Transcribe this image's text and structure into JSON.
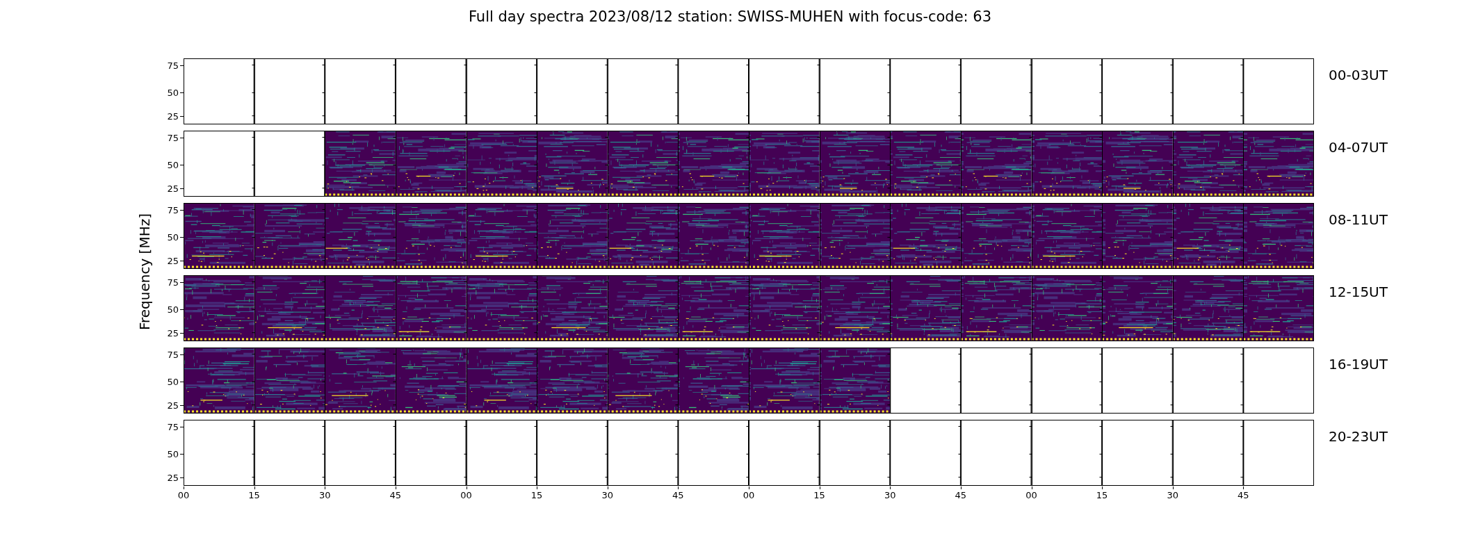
{
  "title": "Full day spectra 2023/08/12 station: SWISS-MUHEN with focus-code: 63",
  "ylabel": "Frequency [MHz]",
  "rows": [
    {
      "label": "00-03UT",
      "yticks": [
        "75",
        "50",
        "25"
      ],
      "panels": [
        {
          "data": false
        },
        {
          "data": false
        },
        {
          "data": false
        },
        {
          "data": false
        },
        {
          "data": false
        },
        {
          "data": false
        },
        {
          "data": false
        },
        {
          "data": false
        },
        {
          "data": false
        },
        {
          "data": false
        },
        {
          "data": false
        },
        {
          "data": false
        },
        {
          "data": false
        },
        {
          "data": false
        },
        {
          "data": false
        },
        {
          "data": false
        }
      ]
    },
    {
      "label": "04-07UT",
      "yticks": [
        "75",
        "50",
        "25"
      ],
      "panels": [
        {
          "data": false
        },
        {
          "data": false
        },
        {
          "data": true
        },
        {
          "data": true
        },
        {
          "data": true
        },
        {
          "data": true
        },
        {
          "data": true
        },
        {
          "data": true
        },
        {
          "data": true
        },
        {
          "data": true
        },
        {
          "data": true
        },
        {
          "data": true
        },
        {
          "data": true
        },
        {
          "data": true
        },
        {
          "data": true
        },
        {
          "data": true
        }
      ]
    },
    {
      "label": "08-11UT",
      "yticks": [
        "75",
        "50",
        "25"
      ],
      "panels": [
        {
          "data": true
        },
        {
          "data": true
        },
        {
          "data": true
        },
        {
          "data": true
        },
        {
          "data": true
        },
        {
          "data": true
        },
        {
          "data": true
        },
        {
          "data": true
        },
        {
          "data": true
        },
        {
          "data": true
        },
        {
          "data": true
        },
        {
          "data": true
        },
        {
          "data": true
        },
        {
          "data": true
        },
        {
          "data": true
        },
        {
          "data": true
        }
      ]
    },
    {
      "label": "12-15UT",
      "yticks": [
        "75",
        "50",
        "25"
      ],
      "panels": [
        {
          "data": true
        },
        {
          "data": true
        },
        {
          "data": true
        },
        {
          "data": true
        },
        {
          "data": true
        },
        {
          "data": true
        },
        {
          "data": true
        },
        {
          "data": true
        },
        {
          "data": true
        },
        {
          "data": true
        },
        {
          "data": true
        },
        {
          "data": true
        },
        {
          "data": true
        },
        {
          "data": true
        },
        {
          "data": true
        },
        {
          "data": true
        }
      ]
    },
    {
      "label": "16-19UT",
      "yticks": [
        "75",
        "50",
        "25"
      ],
      "panels": [
        {
          "data": true
        },
        {
          "data": true
        },
        {
          "data": true
        },
        {
          "data": true
        },
        {
          "data": true
        },
        {
          "data": true
        },
        {
          "data": true
        },
        {
          "data": true
        },
        {
          "data": true
        },
        {
          "data": true
        },
        {
          "data": false
        },
        {
          "data": false
        },
        {
          "data": false
        },
        {
          "data": false
        },
        {
          "data": false
        },
        {
          "data": false
        }
      ]
    },
    {
      "label": "20-23UT",
      "yticks": [
        "75",
        "50",
        "25"
      ],
      "panels": [
        {
          "data": false
        },
        {
          "data": false
        },
        {
          "data": false
        },
        {
          "data": false
        },
        {
          "data": false
        },
        {
          "data": false
        },
        {
          "data": false
        },
        {
          "data": false
        },
        {
          "data": false
        },
        {
          "data": false
        },
        {
          "data": false
        },
        {
          "data": false
        },
        {
          "data": false
        },
        {
          "data": false
        },
        {
          "data": false
        },
        {
          "data": false
        }
      ]
    }
  ],
  "xticks": [
    "00",
    "15",
    "30",
    "45",
    "00",
    "15",
    "30",
    "45",
    "00",
    "15",
    "30",
    "45",
    "00",
    "15",
    "30",
    "45"
  ]
}
